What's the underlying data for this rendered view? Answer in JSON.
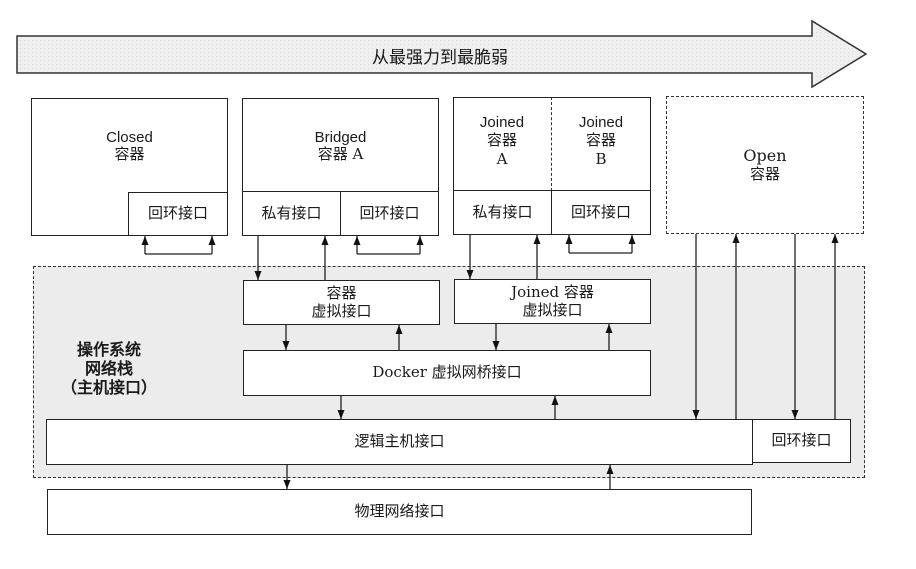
{
  "banner": {
    "label": "从最强力到最脆弱"
  },
  "containers": {
    "closed": {
      "title": "Closed",
      "subtitle": "容器",
      "loopback": "回环接口"
    },
    "bridged": {
      "title": "Bridged",
      "subtitle": "容器 A",
      "private": "私有接口",
      "loopback": "回环接口"
    },
    "joined_a": {
      "title": "Joined",
      "subtitle": "容器",
      "letter": "A",
      "private": "私有接口"
    },
    "joined_b": {
      "title": "Joined",
      "subtitle": "容器",
      "letter": "B",
      "loopback": "回环接口"
    },
    "open": {
      "title": "Open",
      "subtitle": "容器"
    }
  },
  "host": {
    "label_line1": "操作系统",
    "label_line2": "网络栈",
    "label_line3": "（主机接口）",
    "container_veth_line1": "容器",
    "container_veth_line2": "虚拟接口",
    "joined_veth_line1": "Joined 容器",
    "joined_veth_line2": "虚拟接口",
    "docker_bridge": "Docker 虚拟网桥接口",
    "logical_host": "逻辑主机接口",
    "host_loopback": "回环接口"
  },
  "physical": {
    "label": "物理网络接口"
  }
}
